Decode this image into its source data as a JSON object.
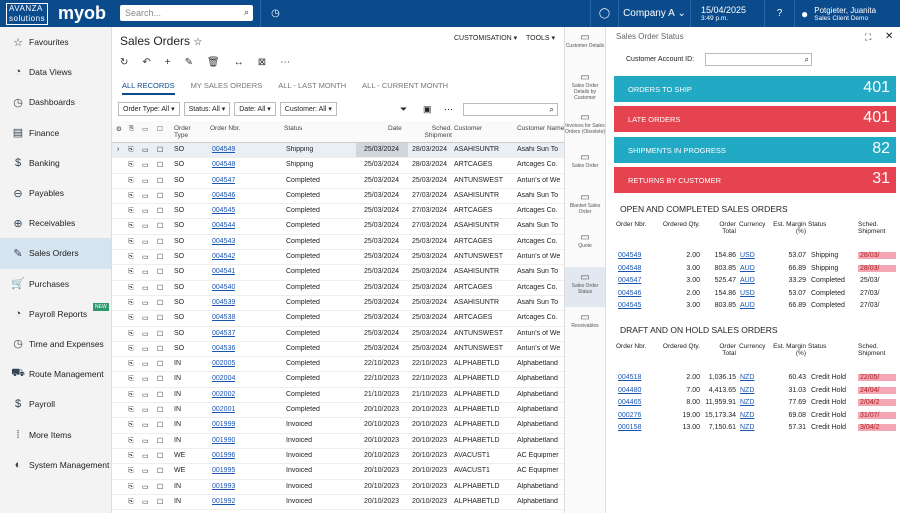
{
  "header": {
    "logo_top": "AVANZA",
    "logo_bottom": "solutions",
    "brand": "myob",
    "search_placeholder": "Search...",
    "company": "Company A",
    "date": "15/04/2025",
    "time": "3:49 p.m.",
    "user": "Potgieter, Juanita",
    "user_role": "Sales Client Demo"
  },
  "sidebar": {
    "items": [
      {
        "icon": "☆",
        "label": "Favourites"
      },
      {
        "icon": "◔",
        "label": "Data Views"
      },
      {
        "icon": "◷",
        "label": "Dashboards"
      },
      {
        "icon": "▤",
        "label": "Finance"
      },
      {
        "icon": "$",
        "label": "Banking"
      },
      {
        "icon": "⊖",
        "label": "Payables"
      },
      {
        "icon": "⊕",
        "label": "Receivables"
      },
      {
        "icon": "✎",
        "label": "Sales Orders"
      },
      {
        "icon": "🛒",
        "label": "Purchases"
      },
      {
        "icon": "◔",
        "label": "Payroll Reports"
      },
      {
        "icon": "◷",
        "label": "Time and Expenses"
      },
      {
        "icon": "⛟",
        "label": "Route Management"
      },
      {
        "icon": "$",
        "label": "Payroll"
      },
      {
        "icon": "⁞",
        "label": "More Items"
      },
      {
        "icon": "◐",
        "label": "System Management"
      }
    ],
    "new_badge": "NEW"
  },
  "page": {
    "title": "Sales Orders",
    "star": "☆",
    "customisation": "CUSTOMISATION",
    "tools": "TOOLS"
  },
  "tabs": [
    "ALL RECORDS",
    "MY SALES ORDERS",
    "ALL - LAST MONTH",
    "ALL - CURRENT MONTH"
  ],
  "filters": [
    "Order Type: All",
    "Status: All",
    "Date: All",
    "Customer: All"
  ],
  "columns": [
    "Order Type",
    "Order Nbr.",
    "Status",
    "Date",
    "Sched. Shipment",
    "Customer",
    "Customer Name"
  ],
  "rows": [
    [
      "SO",
      "004549",
      "Shipping",
      "25/03/2024",
      "28/03/2024",
      "ASAHISUNTR",
      "Asahi Sun To"
    ],
    [
      "SO",
      "004548",
      "Shipping",
      "25/03/2024",
      "28/03/2024",
      "ARTCAGES",
      "Artcages Co."
    ],
    [
      "SO",
      "004547",
      "Completed",
      "25/03/2024",
      "25/03/2024",
      "ANTUNSWEST",
      "Antun's of We"
    ],
    [
      "SO",
      "004546",
      "Completed",
      "25/03/2024",
      "27/03/2024",
      "ASAHISUNTR",
      "Asahi Sun To"
    ],
    [
      "SO",
      "004545",
      "Completed",
      "25/03/2024",
      "27/03/2024",
      "ARTCAGES",
      "Artcages Co."
    ],
    [
      "SO",
      "004544",
      "Completed",
      "25/03/2024",
      "27/03/2024",
      "ASAHISUNTR",
      "Asahi Sun To"
    ],
    [
      "SO",
      "004543",
      "Completed",
      "25/03/2024",
      "25/03/2024",
      "ARTCAGES",
      "Artcages Co."
    ],
    [
      "SO",
      "004542",
      "Completed",
      "25/03/2024",
      "25/03/2024",
      "ANTUNSWEST",
      "Antun's of We"
    ],
    [
      "SO",
      "004541",
      "Completed",
      "25/03/2024",
      "25/03/2024",
      "ASAHISUNTR",
      "Asahi Sun To"
    ],
    [
      "SO",
      "004540",
      "Completed",
      "25/03/2024",
      "25/03/2024",
      "ARTCAGES",
      "Artcages Co."
    ],
    [
      "SO",
      "004539",
      "Completed",
      "25/03/2024",
      "25/03/2024",
      "ASAHISUNTR",
      "Asahi Sun To"
    ],
    [
      "SO",
      "004538",
      "Completed",
      "25/03/2024",
      "25/03/2024",
      "ARTCAGES",
      "Artcages Co."
    ],
    [
      "SO",
      "004537",
      "Completed",
      "25/03/2024",
      "25/03/2024",
      "ANTUNSWEST",
      "Antun's of We"
    ],
    [
      "SO",
      "004536",
      "Completed",
      "25/03/2024",
      "25/03/2024",
      "ANTUNSWEST",
      "Antun's of We"
    ],
    [
      "IN",
      "002005",
      "Completed",
      "22/10/2023",
      "22/10/2023",
      "ALPHABETLD",
      "Alphabetland"
    ],
    [
      "IN",
      "002004",
      "Completed",
      "22/10/2023",
      "22/10/2023",
      "ALPHABETLD",
      "Alphabetland"
    ],
    [
      "IN",
      "002002",
      "Completed",
      "21/10/2023",
      "21/10/2023",
      "ALPHABETLD",
      "Alphabetland"
    ],
    [
      "IN",
      "002001",
      "Completed",
      "20/10/2023",
      "20/10/2023",
      "ALPHABETLD",
      "Alphabetland"
    ],
    [
      "IN",
      "001999",
      "Invoiced",
      "20/10/2023",
      "20/10/2023",
      "ALPHABETLD",
      "Alphabetland"
    ],
    [
      "IN",
      "001990",
      "Invoiced",
      "20/10/2023",
      "20/10/2023",
      "ALPHABETLD",
      "Alphabetland"
    ],
    [
      "WE",
      "001996",
      "Invoiced",
      "20/10/2023",
      "20/10/2023",
      "AVACUST1",
      "AC Equipmer"
    ],
    [
      "WE",
      "001995",
      "Invoiced",
      "20/10/2023",
      "20/10/2023",
      "AVACUST1",
      "AC Equipmer"
    ],
    [
      "IN",
      "001993",
      "Invoiced",
      "20/10/2023",
      "20/10/2023",
      "ALPHABETLD",
      "Alphabetland"
    ],
    [
      "IN",
      "001992",
      "Invoiced",
      "20/10/2023",
      "20/10/2023",
      "ALPHABETLD",
      "Alphabetland"
    ]
  ],
  "rail": [
    "Customer Details",
    "Sales Order Details by Customer",
    "Invoices for Sales Orders (Obsolete)",
    "Sales Order",
    "Blanket Sales Order",
    "Quote",
    "Sales Order Status",
    "Receivables"
  ],
  "panel": {
    "title": "Sales Order Status",
    "cust_label": "Customer Account ID:",
    "kpis": [
      {
        "label": "ORDERS TO SHIP",
        "value": "401",
        "color": "#22a9c4"
      },
      {
        "label": "LATE ORDERS",
        "value": "401",
        "color": "#e4434f"
      },
      {
        "label": "SHIPMENTS IN PROGRESS",
        "value": "82",
        "color": "#22a9c4"
      },
      {
        "label": "RETURNS BY CUSTOMER",
        "value": "31",
        "color": "#e4434f"
      }
    ],
    "sec1": "OPEN AND COMPLETED SALES ORDERS",
    "sec2": "DRAFT AND ON HOLD SALES ORDERS",
    "cols": [
      "Order Nbr.",
      "Ordered Qty.",
      "Order Total",
      "Currency",
      "Est. Margin (%)",
      "Status",
      "Sched. Shipment"
    ],
    "open": [
      [
        "004549",
        "2.00",
        "154.86",
        "USD",
        "53.07",
        "Shipping",
        "28/03/"
      ],
      [
        "004548",
        "3.00",
        "803.85",
        "AUD",
        "66.89",
        "Shipping",
        "28/03/"
      ],
      [
        "004547",
        "3.00",
        "525.47",
        "AUD",
        "33.29",
        "Completed",
        "25/03/"
      ],
      [
        "004546",
        "2.00",
        "154.86",
        "USD",
        "53.07",
        "Completed",
        "27/03/"
      ],
      [
        "004545",
        "3.00",
        "803.85",
        "AUD",
        "66.89",
        "Completed",
        "27/03/"
      ]
    ],
    "draft": [
      [
        "004518",
        "2.00",
        "1,036.15",
        "NZD",
        "60.43",
        "Credit Hold",
        "22/05/"
      ],
      [
        "004480",
        "7.00",
        "4,413.65",
        "NZD",
        "31.03",
        "Credit Hold",
        "24/04/"
      ],
      [
        "004465",
        "8.00",
        "11,959.91",
        "NZD",
        "77.69",
        "Credit Hold",
        "2/04/2"
      ],
      [
        "000276",
        "19.00",
        "15,173.34",
        "NZD",
        "69.08",
        "Credit Hold",
        "31/07/"
      ],
      [
        "000158",
        "13.00",
        "7,150.61",
        "NZD",
        "57.31",
        "Credit Hold",
        "3/04/2"
      ]
    ]
  }
}
